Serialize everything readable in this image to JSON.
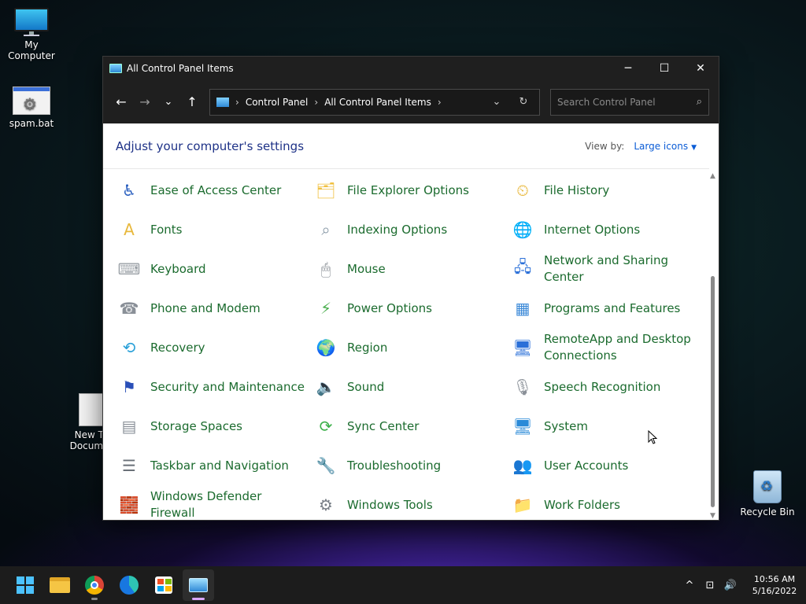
{
  "desktop": {
    "icons": [
      {
        "label": "My Computer"
      },
      {
        "label": "spam.bat"
      },
      {
        "label": "New Text Document"
      },
      {
        "label": "Recycle Bin"
      }
    ],
    "partial_labels": {
      "line1": "New Te",
      "line2": "Documer"
    }
  },
  "window": {
    "title": "All Control Panel Items",
    "controls": {
      "minimize": "─",
      "maximize": "☐",
      "close": "✕"
    },
    "nav": {
      "back": "←",
      "forward": "→",
      "recent": "⌄",
      "up": "↑"
    },
    "breadcrumb": [
      "Control Panel",
      "All Control Panel Items"
    ],
    "search_placeholder": "Search Control Panel",
    "header": "Adjust your computer's settings",
    "view_by_label": "View by:",
    "view_by_value": "Large icons"
  },
  "items": [
    {
      "label": "Ease of Access Center",
      "icon": "ease-of-access-icon",
      "color": "#2a5fbf"
    },
    {
      "label": "File Explorer Options",
      "icon": "folder-options-icon",
      "color": "#f0c040"
    },
    {
      "label": "File History",
      "icon": "file-history-icon",
      "color": "#e8b83c"
    },
    {
      "label": "Fonts",
      "icon": "fonts-icon",
      "color": "#e8b83c"
    },
    {
      "label": "Indexing Options",
      "icon": "indexing-icon",
      "color": "#8a9aa8"
    },
    {
      "label": "Internet Options",
      "icon": "internet-options-icon",
      "color": "#3c8ad8"
    },
    {
      "label": "Keyboard",
      "icon": "keyboard-icon",
      "color": "#9aa0a6"
    },
    {
      "label": "Mouse",
      "icon": "mouse-icon",
      "color": "#7a8088"
    },
    {
      "label": "Network and Sharing Center",
      "icon": "network-icon",
      "color": "#2a6fd8"
    },
    {
      "label": "Phone and Modem",
      "icon": "phone-icon",
      "color": "#8a9098"
    },
    {
      "label": "Power Options",
      "icon": "power-options-icon",
      "color": "#4caf50"
    },
    {
      "label": "Programs and Features",
      "icon": "programs-icon",
      "color": "#3c8ad8"
    },
    {
      "label": "Recovery",
      "icon": "recovery-icon",
      "color": "#2aa0d8"
    },
    {
      "label": "Region",
      "icon": "region-icon",
      "color": "#3c8ad8"
    },
    {
      "label": "RemoteApp and Desktop Connections",
      "icon": "remoteapp-icon",
      "color": "#2a6fd8"
    },
    {
      "label": "Security and Maintenance",
      "icon": "security-flag-icon",
      "color": "#2a4fb8"
    },
    {
      "label": "Sound",
      "icon": "sound-icon",
      "color": "#8a9098"
    },
    {
      "label": "Speech Recognition",
      "icon": "microphone-icon",
      "color": "#8a9098"
    },
    {
      "label": "Storage Spaces",
      "icon": "storage-icon",
      "color": "#8a9098"
    },
    {
      "label": "Sync Center",
      "icon": "sync-icon",
      "color": "#3cb04a"
    },
    {
      "label": "System",
      "icon": "system-icon",
      "color": "#2a8ad8"
    },
    {
      "label": "Taskbar and Navigation",
      "icon": "taskbar-icon",
      "color": "#6a7078"
    },
    {
      "label": "Troubleshooting",
      "icon": "troubleshooting-icon",
      "color": "#5a8ac8"
    },
    {
      "label": "User Accounts",
      "icon": "user-accounts-icon",
      "color": "#4a9a5a"
    },
    {
      "label": "Windows Defender Firewall",
      "icon": "firewall-icon",
      "color": "#b84a2a"
    },
    {
      "label": "Windows Tools",
      "icon": "windows-tools-icon",
      "color": "#7a8088"
    },
    {
      "label": "Work Folders",
      "icon": "work-folders-icon",
      "color": "#e8b83c"
    }
  ],
  "taskbar": {
    "apps": [
      "start-icon",
      "file-explorer-icon",
      "chrome-icon",
      "edge-icon",
      "store-icon",
      "control-panel-icon"
    ],
    "tray": {
      "chevron": "^",
      "network": "⊡",
      "volume": "🔊"
    },
    "time": "10:56 AM",
    "date": "5/16/2022"
  },
  "colors": {
    "link_green": "#1b6b2e",
    "header_blue": "#1e3287",
    "accent": "#0b5cd6",
    "titlebar": "#1f1f1f"
  }
}
